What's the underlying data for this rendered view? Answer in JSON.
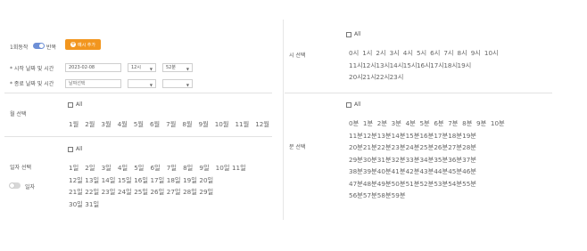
{
  "repeat": {
    "once_label": "1회동작",
    "repeat_label": "반복",
    "add_button_label": "예시 추가"
  },
  "start": {
    "label": "* 시작 날짜 및 시간",
    "date": "2023-02-08",
    "hour": "12시",
    "minute": "52분"
  },
  "end": {
    "label": "* 종료 날짜 및 시간",
    "date_placeholder": "날짜선택",
    "hour": "",
    "minute": ""
  },
  "month": {
    "label": "월 선택",
    "all_label": "All",
    "rows": [
      [
        "1월",
        "2월",
        "3월",
        "4월",
        "5월",
        "6월",
        "7월",
        "8월",
        "9월",
        "10월",
        "11월",
        "12월"
      ]
    ]
  },
  "day": {
    "label": "일자 선택",
    "toggle_label": "일자",
    "all_label": "All",
    "rows": [
      [
        "1일",
        "2일",
        "3일",
        "4일",
        "5일",
        "6일",
        "7일",
        "8일",
        "9일",
        "10일",
        "11일"
      ],
      [
        "12일",
        "13일",
        "14일",
        "15일",
        "16일",
        "17일",
        "18일",
        "19일",
        "20일"
      ],
      [
        "21일",
        "22일",
        "23일",
        "24일",
        "25일",
        "26일",
        "27일",
        "28일",
        "29일"
      ],
      [
        "30일",
        "31일"
      ]
    ]
  },
  "hour_select": {
    "label": "시 선택",
    "all_label": "All",
    "rows": [
      [
        "0시",
        "1시",
        "2시",
        "3시",
        "4시",
        "5시",
        "6시",
        "7시",
        "8시",
        "9시",
        "10시"
      ],
      [
        "11시",
        "12시",
        "13시",
        "14시",
        "15시",
        "16시",
        "17시",
        "18시",
        "19시"
      ],
      [
        "20시",
        "21시",
        "22시",
        "23시"
      ]
    ]
  },
  "minute_select": {
    "label": "분 선택",
    "all_label": "All",
    "rows": [
      [
        "0분",
        "1분",
        "2분",
        "3분",
        "4분",
        "5분",
        "6분",
        "7분",
        "8분",
        "9분",
        "10분"
      ],
      [
        "11분",
        "12분",
        "13분",
        "14분",
        "15분",
        "16분",
        "17분",
        "18분",
        "19분"
      ],
      [
        "20분",
        "21분",
        "22분",
        "23분",
        "24분",
        "25분",
        "26분",
        "27분",
        "28분"
      ],
      [
        "29분",
        "30분",
        "31분",
        "32분",
        "33분",
        "34분",
        "35분",
        "36분",
        "37분"
      ],
      [
        "38분",
        "39분",
        "40분",
        "41분",
        "42분",
        "43분",
        "44분",
        "45분",
        "46분"
      ],
      [
        "47분",
        "48분",
        "49분",
        "50분",
        "51분",
        "52분",
        "53분",
        "54분",
        "55분"
      ],
      [
        "56분",
        "57분",
        "58분",
        "59분"
      ]
    ]
  },
  "colors": {
    "accent_orange": "#f2961f",
    "toggle_on": "#6d8fd6"
  }
}
